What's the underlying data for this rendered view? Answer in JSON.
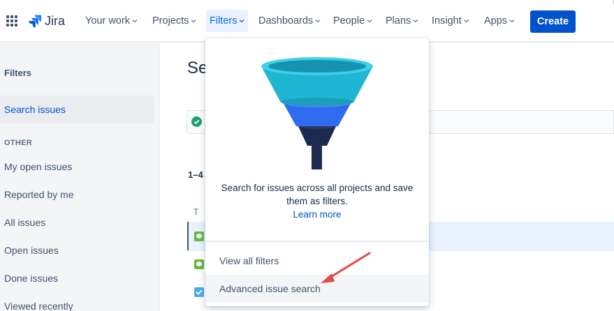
{
  "topnav": {
    "brand": "Jira",
    "items": [
      {
        "label": "Your work"
      },
      {
        "label": "Projects"
      },
      {
        "label": "Filters"
      },
      {
        "label": "Dashboards"
      },
      {
        "label": "People"
      },
      {
        "label": "Plans"
      },
      {
        "label": "Insight"
      },
      {
        "label": "Apps"
      }
    ],
    "active_item": "Filters",
    "create_label": "Create"
  },
  "sidebar": {
    "title": "Filters",
    "selected_item": "Search issues",
    "section_label": "OTHER",
    "items": [
      {
        "label": "My open issues"
      },
      {
        "label": "Reported by me"
      },
      {
        "label": "All issues"
      },
      {
        "label": "Open issues"
      },
      {
        "label": "Done issues"
      },
      {
        "label": "Viewed recently"
      }
    ]
  },
  "main": {
    "title": "Se",
    "count_label": "1–4",
    "column_header": "T"
  },
  "dropdown": {
    "description": "Search for issues across all projects and save them as filters.",
    "link_label": "Learn more",
    "items": [
      {
        "label": "View all filters"
      },
      {
        "label": "Advanced issue search"
      }
    ]
  },
  "colors": {
    "brand_blue": "#0052cc",
    "active_nav_bg": "#e9f2ff",
    "annotation_arrow": "#e34a4a",
    "funnel_top": "#1fb6d3",
    "funnel_middle": "#2f6cf0",
    "funnel_bottom": "#1b2a4e"
  },
  "icons": [
    "apps-grid-icon",
    "jira-logo-icon",
    "chevron-down-icon",
    "funnel-illustration",
    "check-circle-icon",
    "story-icon",
    "task-icon"
  ]
}
